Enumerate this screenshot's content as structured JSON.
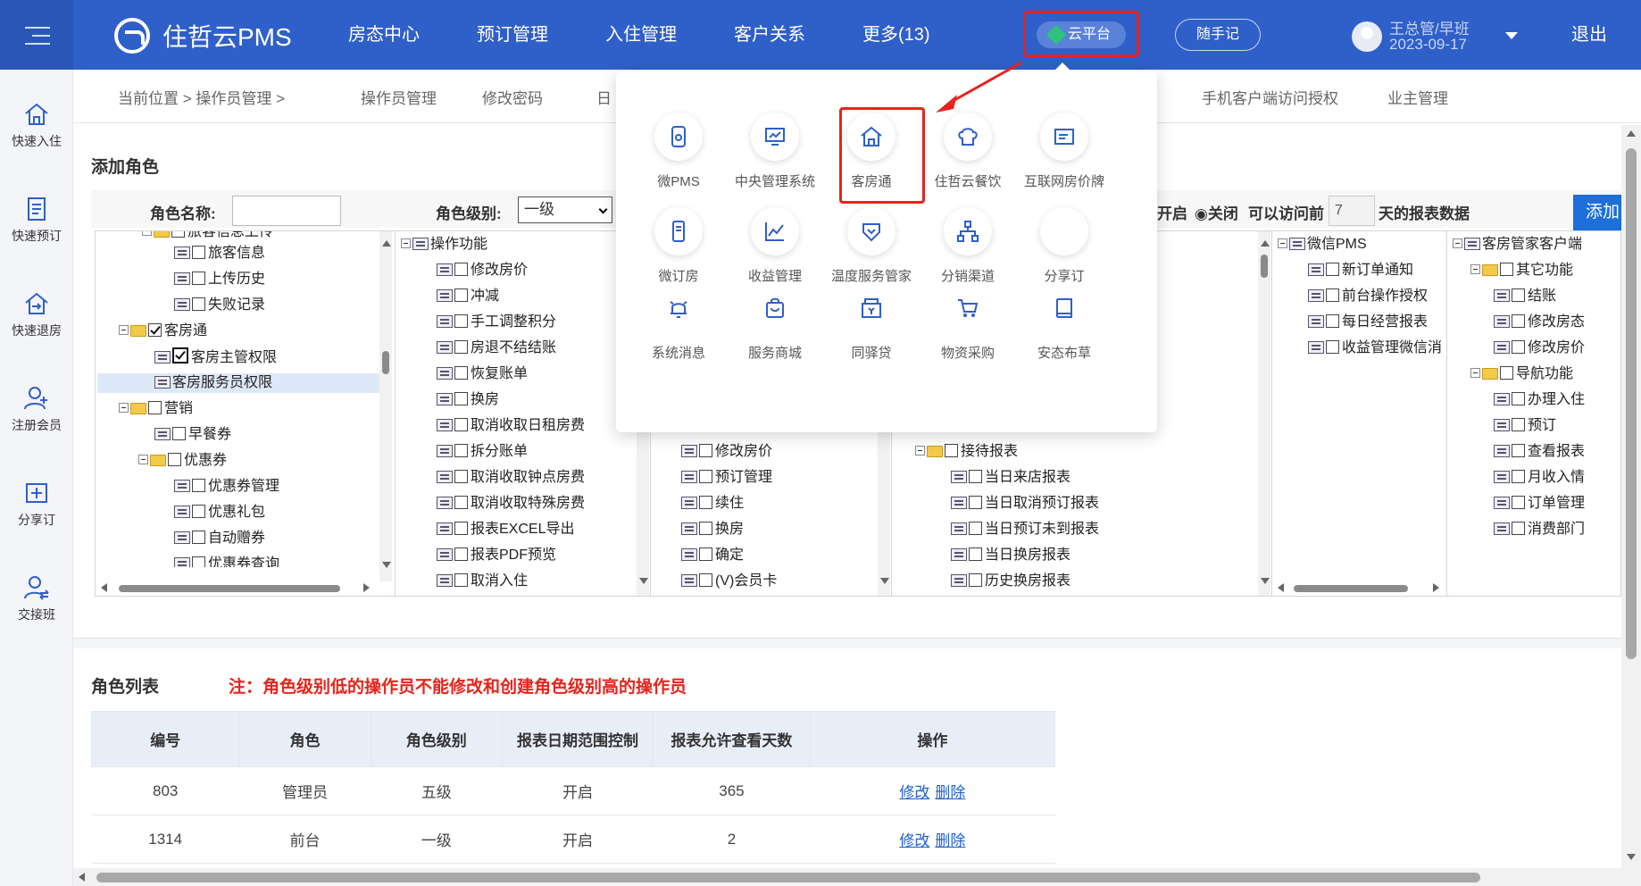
{
  "header": {
    "brand": "住哲云PMS",
    "nav": [
      "房态中心",
      "预订管理",
      "入住管理",
      "客户关系",
      "更多(13)"
    ],
    "cloud_label": "云平台",
    "notes_label": "随手记",
    "user_name": "王总管/早班",
    "user_date": "2023-09-17",
    "logout_label": "退出"
  },
  "sidebar": {
    "items": [
      "快速入住",
      "快速预订",
      "快速退房",
      "注册会员",
      "分享订",
      "交接班"
    ]
  },
  "breadcrumb": {
    "current": "当前位置 > 操作员管理 >",
    "tabs": [
      "操作员管理",
      "修改密码",
      "日"
    ],
    "right_tabs": [
      "手机客户端访问授权",
      "业主管理"
    ]
  },
  "add_role": {
    "title": "添加角色",
    "name_label": "角色名称:",
    "level_label": "角色级别:",
    "level_value": "一级",
    "open_text": "开启",
    "close_text": "◉关闭",
    "access_prefix": "可以访问前",
    "days_value": "7",
    "access_suffix": "天的报表数据",
    "add_button": "添加"
  },
  "tree": {
    "panel1": [
      "旅客信息上传",
      "旅客信息",
      "上传历史",
      "失败记录",
      "客房通",
      "客房主管权限",
      "客房服务员权限",
      "营销",
      "早餐券",
      "优惠券",
      "优惠券管理",
      "优惠礼包",
      "自动赠券",
      "优惠券查询"
    ],
    "panel2": [
      "操作功能",
      "修改房价",
      "冲减",
      "手工调整积分",
      "房退不结结账",
      "恢复账单",
      "换房",
      "取消收取日租房费",
      "拆分账单",
      "取消收取钟点房费",
      "取消收取特殊房费",
      "报表EXCEL导出",
      "报表PDF预览",
      "取消入住"
    ],
    "panel3": [
      "修改房价",
      "预订管理",
      "续住",
      "换房",
      "确定",
      "(V)会员卡"
    ],
    "panel4": [
      "接待报表",
      "当日来店报表",
      "当日取消预订报表",
      "当日预订未到报表",
      "当日换房报表",
      "历史换房报表"
    ],
    "panel5": [
      "微信PMS",
      "新订单通知",
      "前台操作授权",
      "每日经营报表",
      "收益管理微信消"
    ],
    "panel6": [
      "客房管家客户端",
      "其它功能",
      "结账",
      "修改房态",
      "修改房价",
      "导航功能",
      "办理入住",
      "预订",
      "查看报表",
      "月收入情",
      "订单管理",
      "消费部门"
    ]
  },
  "cloud_menu": {
    "apps": [
      "微PMS",
      "中央管理系统",
      "客房通",
      "住哲云餐饮",
      "互联网房价牌",
      "微订房",
      "收益管理",
      "温度服务管家",
      "分销渠道",
      "分享订",
      "系统消息",
      "服务商城",
      "同驿贷",
      "物资采购",
      "安态布草"
    ]
  },
  "role_list": {
    "title": "角色列表",
    "note": "注：角色级别低的操作员不能修改和创建角色级别高的操作员",
    "headers": [
      "编号",
      "角色",
      "角色级别",
      "报表日期范围控制",
      "报表允许查看天数",
      "操作"
    ],
    "rows": [
      {
        "id": "803",
        "role": "管理员",
        "level": "五级",
        "range": "开启",
        "days": "365"
      },
      {
        "id": "1314",
        "role": "前台",
        "level": "一级",
        "range": "开启",
        "days": "2"
      }
    ],
    "edit_label": "修改",
    "delete_label": "删除"
  },
  "colors": {
    "header_bg": "#2f5fc9",
    "highlight": "#e8231c",
    "link": "#1e5fd0",
    "add_button": "#1e6fd9"
  }
}
